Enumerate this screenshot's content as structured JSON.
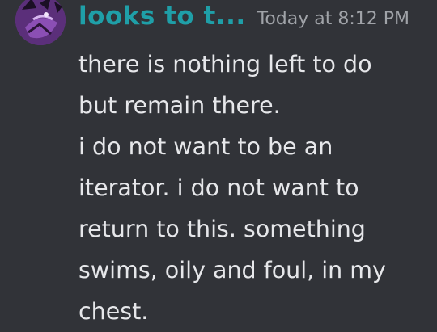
{
  "message": {
    "author": "looks to t...",
    "timestamp": "Today at 8:12 PM",
    "lines": [
      "there is nothing left to do",
      "but remain there.",
      "i do not want to be an",
      "iterator. i do not want to",
      "return to this. something",
      "swims, oily and foul, in my",
      "chest."
    ]
  },
  "colors": {
    "background": "#313338",
    "username": "#1f9fa8",
    "timestamp": "#a0a3a8",
    "text": "#e6e7ea",
    "avatar": "#6a3a8c"
  },
  "avatar_icon": "purple-creature-avatar-icon"
}
